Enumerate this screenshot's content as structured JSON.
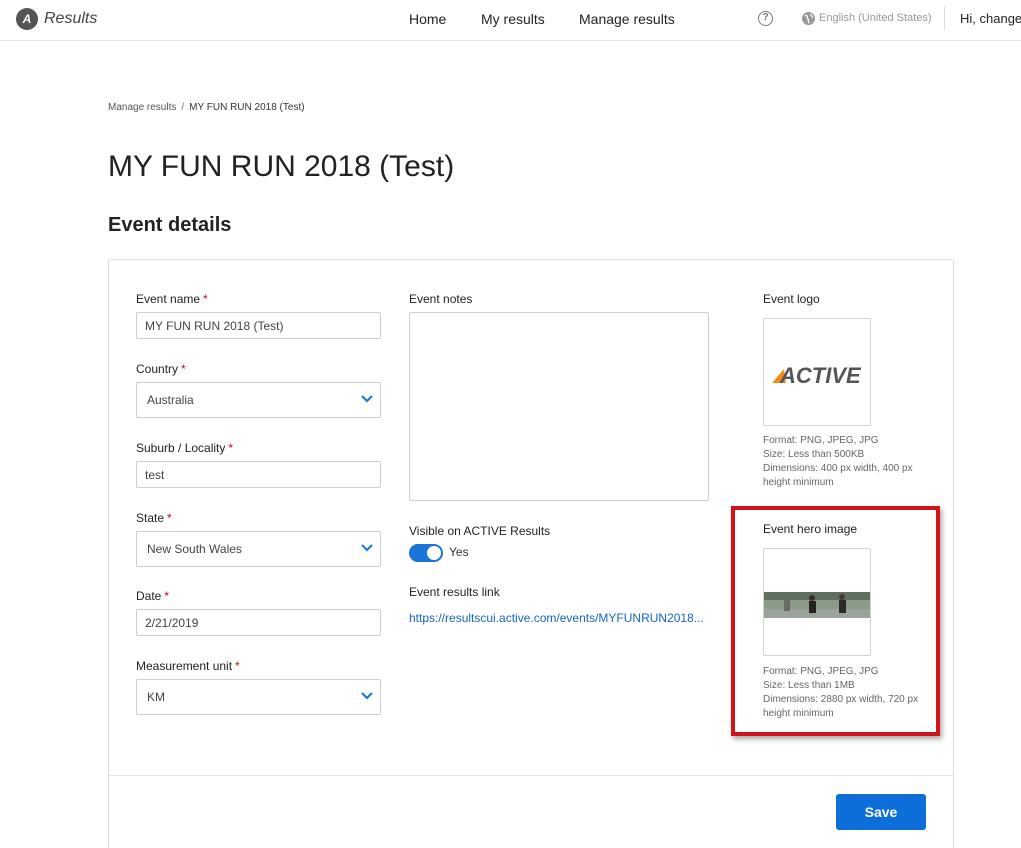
{
  "header": {
    "logo_text": "Results",
    "nav": [
      "Home",
      "My results",
      "Manage results"
    ],
    "language": "English (United States)",
    "greeting": "Hi, change"
  },
  "breadcrumb": {
    "parent": "Manage results",
    "current": "MY FUN RUN 2018 (Test)"
  },
  "page_title": "MY FUN RUN 2018 (Test)",
  "section_title": "Event details",
  "form": {
    "event_name": {
      "label": "Event name",
      "value": "MY FUN RUN 2018 (Test)"
    },
    "country": {
      "label": "Country",
      "value": "Australia"
    },
    "suburb": {
      "label": "Suburb / Locality",
      "value": "test"
    },
    "state": {
      "label": "State",
      "value": "New South Wales"
    },
    "date": {
      "label": "Date",
      "value": "2/21/2019"
    },
    "measurement_unit": {
      "label": "Measurement unit",
      "value": "KM"
    },
    "event_notes": {
      "label": "Event notes",
      "value": ""
    },
    "visible": {
      "label": "Visible on ACTIVE Results",
      "value": "Yes",
      "on": true
    },
    "results_link": {
      "label": "Event results link",
      "value": "https://resultscui.active.com/events/MYFUNRUN2018..."
    },
    "event_logo": {
      "label": "Event logo",
      "logo_text": "ACTIVE",
      "format": "Format: PNG, JPEG, JPG",
      "size": "Size: Less than 500KB",
      "dimensions": "Dimensions: 400 px width, 400 px height minimum"
    },
    "hero_image": {
      "label": "Event hero image",
      "format": "Format: PNG, JPEG, JPG",
      "size": "Size: Less than 1MB",
      "dimensions": "Dimensions: 2880 px width, 720 px height minimum"
    },
    "save_label": "Save"
  },
  "colors": {
    "accent": "#0d6ed9",
    "required": "#d0021b",
    "highlight": "#d0141a",
    "toggle": "#1a73d9"
  }
}
